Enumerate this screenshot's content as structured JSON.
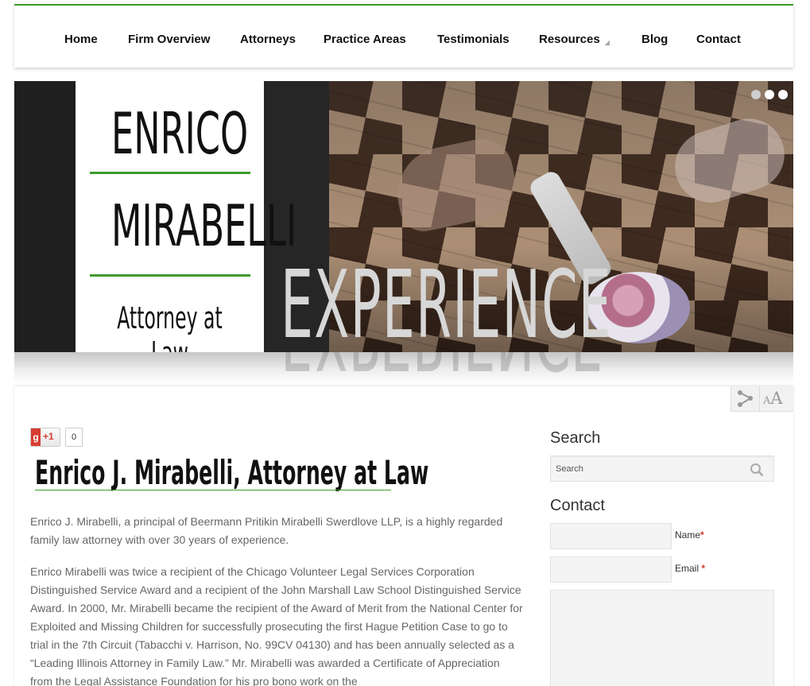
{
  "nav": {
    "items": [
      {
        "label": "Home"
      },
      {
        "label": "Firm Overview"
      },
      {
        "label": "Attorneys"
      },
      {
        "label": "Practice Areas"
      },
      {
        "label": "Testimonials"
      },
      {
        "label": "Resources"
      },
      {
        "label": "Blog"
      },
      {
        "label": "Contact"
      }
    ]
  },
  "hero": {
    "card_line1": "ENRICO",
    "card_line2": "MIRABELLI",
    "card_line3": "Attorney at Law",
    "banner_word": "EXPERIENCE",
    "slides": 3,
    "active_slide": 3
  },
  "tools": {
    "share_icon": "share-nodes-icon",
    "font_small": "A",
    "font_large": "A"
  },
  "gplus": {
    "label": "+1",
    "count": "0"
  },
  "page": {
    "title": "Enrico J. Mirabelli, Attorney at Law",
    "paragraph1": "Enrico J. Mirabelli, a principal of Beermann Pritikin Mirabelli Swerdlove LLP, is a highly regarded family law attorney with over 30 years of experience.",
    "paragraph2": "Enrico Mirabelli was twice a recipient of the Chicago Volunteer Legal Services Corporation Distinguished Service Award and a recipient of the John Marshall Law School Distinguished Service Award. In 2000, Mr. Mirabelli became the recipient of the Award of Merit from the National Center for Exploited and Missing Children for successfully prosecuting the first Hague Petition Case to go to trial in the 7th Circuit (Tabacchi v. Harrison, No. 99CV 04130) and has been annually selected as a “Leading Illinois Attorney in Family Law.” Mr. Mirabelli was awarded a Certificate of Appreciation from the Legal Assistance Foundation for his pro bono work on the"
  },
  "sidebar": {
    "search_heading": "Search",
    "search_placeholder": "Search",
    "contact_heading": "Contact",
    "name_label": "Name",
    "email_label": "Email",
    "required_mark": "*"
  },
  "colors": {
    "accent": "#3d9b2c",
    "required": "#d0352b"
  }
}
